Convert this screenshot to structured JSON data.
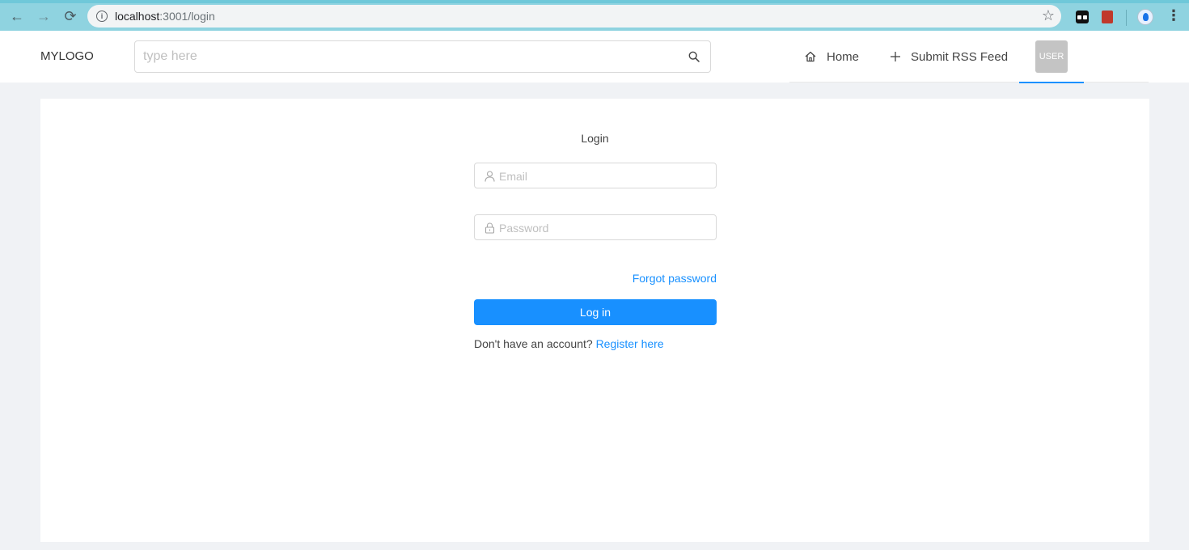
{
  "browser": {
    "url_host": "localhost",
    "url_rest": ":3001/login",
    "back_icon": "arrow-left-icon",
    "forward_icon": "arrow-right-icon",
    "reload_icon": "reload-icon",
    "back_glyph": "←",
    "forward_glyph": "→",
    "reload_glyph": "⟳",
    "info_glyph": "i",
    "star_glyph": "☆",
    "menu_glyph": "⋮"
  },
  "header": {
    "logo": "MYLOGO",
    "search_placeholder": "type here",
    "menu": {
      "home_label": "Home",
      "submit_label": "Submit RSS Feed",
      "user_label": "USER"
    },
    "accent_color": "#1890ff"
  },
  "login": {
    "title": "Login",
    "email_placeholder": "Email",
    "password_placeholder": "Password",
    "forgot_label": "Forgot password",
    "submit_label": "Log in",
    "no_account_text": "Don't have an account?",
    "register_label": "Register here"
  }
}
